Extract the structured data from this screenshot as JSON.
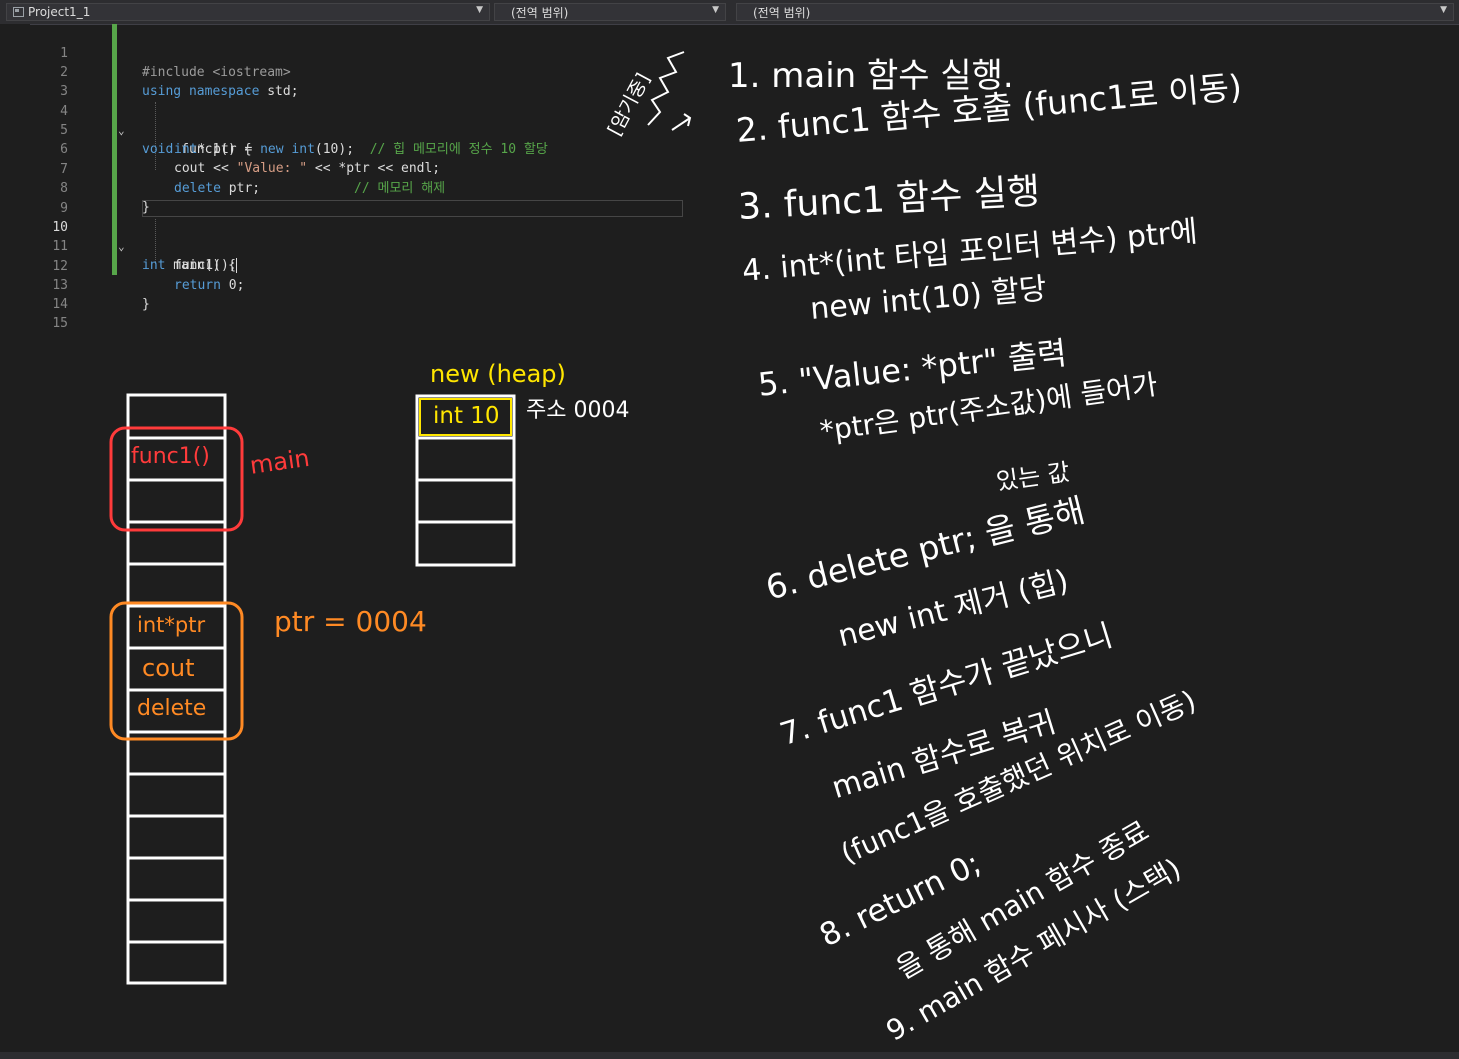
{
  "navbar": {
    "project": "Project1_1",
    "scope1": "(전역 범위)",
    "scope2": "(전역 범위)"
  },
  "editor": {
    "line_numbers": [
      "1",
      "2",
      "3",
      "4",
      "5",
      "6",
      "7",
      "8",
      "9",
      "10",
      "11",
      "12",
      "13",
      "14",
      "15"
    ],
    "lines": [
      {
        "a": "#include <iostream>"
      },
      {
        "a": "using namespace",
        "b": " std;"
      },
      {},
      {
        "a": "void",
        "b": " func1() {"
      },
      {
        "a": "int",
        "b": "* ptr = ",
        "c": "new",
        "d": " int",
        "e": "(10);  ",
        "f": "// 힙 메모리에 정수 10 할당"
      },
      {
        "a": "cout << ",
        "b": "\"Value: \"",
        "c": " << *ptr << endl;"
      },
      {
        "a": "delete",
        "b": " ptr;            ",
        "c": "// 메모리 해제"
      },
      {
        "a": "}"
      },
      {},
      {
        "a": "int",
        "b": " main() {"
      },
      {
        "a": "func1();"
      },
      {
        "a": "return",
        "b": " 0;"
      },
      {
        "a": "}"
      },
      {},
      {}
    ]
  },
  "diagram": {
    "stack_main_label": "func1()",
    "main_label": "main",
    "stack_func_items": [
      "int*ptr",
      "cout",
      "delete"
    ],
    "ptr_value": "ptr = 0004",
    "heap_title": "new (heap)",
    "heap_item": "int 10",
    "heap_address": "주소 0004",
    "side_note": "[암기중]"
  },
  "notes": [
    "1. main 함수 실행.",
    "2. func1 함수 호출 (func1로 이동)",
    "3. func1 함수 실행",
    "4. int*(int 타입 포인터 변수) ptr에",
    "new int(10) 할당",
    "5. \"Value: *ptr\" 출력",
    "*ptr은 ptr(주소값)에 들어가",
    "있는 값",
    "6. delete ptr; 을 통해",
    "new int 제거 (힙)",
    "7. func1 함수가 끝났으니",
    "main 함수로 복귀",
    "(func1을 호출했던 위치로 이동)",
    "8. return 0;",
    "을 통해 main 함수 종료",
    "9. main 함수 페시사 (스택)"
  ],
  "colors": {
    "background": "#1e1e1e",
    "change_bar": "#57a64a",
    "red": "#ff3b3b",
    "orange": "#ff8a24",
    "yellow": "#ffe600"
  }
}
